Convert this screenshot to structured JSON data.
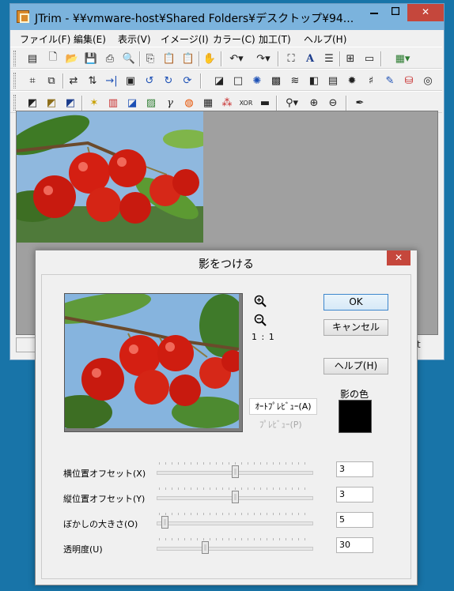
{
  "window": {
    "title": "JTrim - ¥¥vmware-host¥Shared Folders¥デスクトップ¥94..."
  },
  "menu": [
    "ファイル(F)",
    "編集(E)",
    "表示(V)",
    "イメージ(I)",
    "カラー(C)",
    "加工(T)",
    "ヘルプ(H)"
  ],
  "status": {
    "right_text": "bit"
  },
  "dialog": {
    "title": "影をつける",
    "close_label": "✕",
    "zoom_label": "1 : 1",
    "ok_label": "OK",
    "cancel_label": "キャンセル",
    "help_label": "ヘルプ(H)",
    "auto_preview_label": "ｵｰﾄﾌﾟﾚﾋﾞｭｰ(A)",
    "preview_label": "ﾌﾟﾚﾋﾞｭｰ(P)",
    "shadow_color_label": "影の色",
    "shadow_color": "#000000",
    "params": [
      {
        "label": "横位置オフセット(X)",
        "value": "3",
        "slider": 0.5
      },
      {
        "label": "縦位置オフセット(Y)",
        "value": "3",
        "slider": 0.5
      },
      {
        "label": "ぼかしの大きさ(O)",
        "value": "5",
        "slider": 0.03
      },
      {
        "label": "透明度(U)",
        "value": "30",
        "slider": 0.3
      }
    ]
  },
  "colors": {
    "desktop": "#1874a8",
    "titlebar": "#7bb3dd",
    "close_button": "#c5473c",
    "canvas_background": "#a0a0a0"
  },
  "toolbar_icons": {
    "row1": [
      "new-window-icon",
      "new-icon",
      "open-icon",
      "save-icon",
      "print-icon",
      "print-preview-icon",
      "copy-icon",
      "paste-icon",
      "paste-new-icon",
      "effect-icon",
      "undo-icon",
      "redo-icon",
      "fit-icon",
      "text-icon",
      "align-icon",
      "grid-icon",
      "film-icon",
      "color-grid-icon"
    ],
    "row2": [
      "crop-icon",
      "auto-crop-icon",
      "flip-h-icon",
      "flip-v-icon",
      "resize-icon",
      "frame-icon",
      "rotate-left-icon",
      "rotate-right-icon",
      "rotate-free-icon",
      "shadow-icon",
      "square-icon",
      "spot-icon",
      "mosaic-icon",
      "wave-icon",
      "emboss-icon",
      "brick-icon",
      "sharpen-icon",
      "blur-icon",
      "brush-icon",
      "bucket-icon",
      "swirl-icon"
    ],
    "row3": [
      "gradient-icon",
      "sepia-icon",
      "gradient-blue-icon",
      "sparkle-icon",
      "palette-icon",
      "contrast-icon",
      "image-icon",
      "gamma-icon",
      "color-wheel-icon",
      "dither-icon",
      "rgb-icon",
      "xor-icon",
      "levels-icon",
      "zoom-icon",
      "zoom-in-icon",
      "zoom-out-icon",
      "eyedropper-icon"
    ]
  }
}
